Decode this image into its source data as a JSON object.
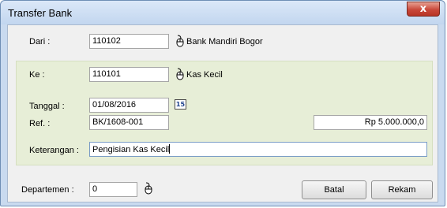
{
  "window": {
    "title": "Transfer Bank",
    "close_glyph": "x"
  },
  "dari": {
    "label": "Dari :",
    "code": "110102",
    "name": "Bank Mandiri Bogor",
    "icon": "mouse-icon"
  },
  "ke": {
    "label": "Ke :",
    "code": "110101",
    "name": "Kas Kecil",
    "icon": "mouse-icon"
  },
  "tanggal": {
    "label": "Tanggal :",
    "value": "01/08/2016",
    "calendar_glyph": "15",
    "icon": "calendar-icon"
  },
  "ref": {
    "label": "Ref. :",
    "value": "BK/1608-001",
    "amount": "Rp 5.000.000,0"
  },
  "keterangan": {
    "label": "Keterangan :",
    "value": "Pengisian Kas Kecil"
  },
  "departemen": {
    "label": "Departemen :",
    "value": "0",
    "icon": "mouse-icon"
  },
  "buttons": {
    "batal": "Batal",
    "rekam": "Rekam"
  },
  "colors": {
    "panel_green": "#e7eed7",
    "close_red": "#c9483a",
    "frame_blue": "#c9daef"
  }
}
